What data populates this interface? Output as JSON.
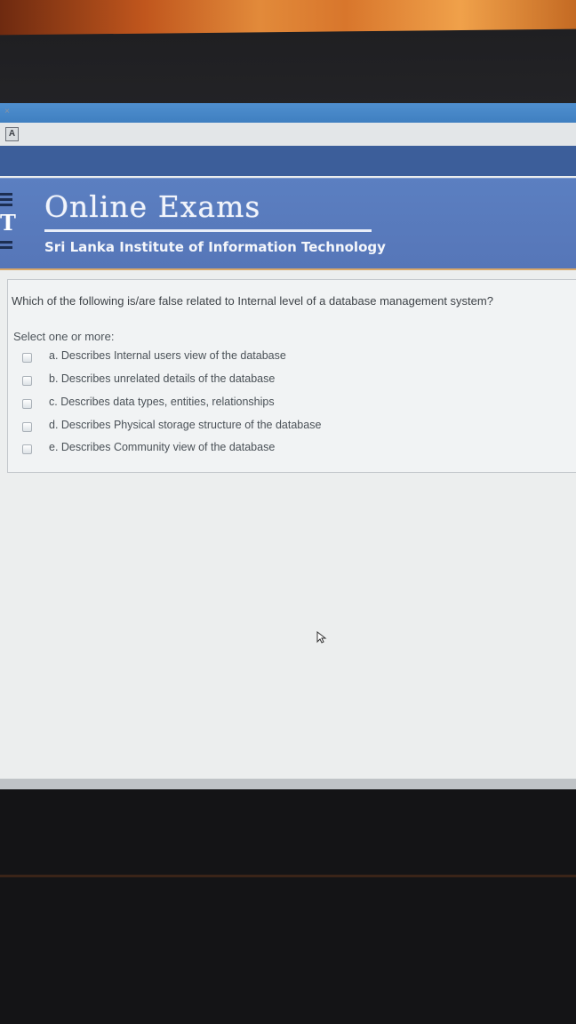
{
  "window": {
    "close_glyph": "×",
    "app_icon_glyph": "A"
  },
  "banner": {
    "title": "Online Exams",
    "subtitle": "Sri Lanka Institute of Information Technology",
    "logo_letter": "T"
  },
  "question": {
    "text": "Which of the following is/are false related to Internal level of a database management system?",
    "select_label": "Select one or more:",
    "answers": [
      {
        "label": "a. Describes Internal users view of the database",
        "checked": false
      },
      {
        "label": "b. Describes unrelated details of the database",
        "checked": false
      },
      {
        "label": "c. Describes data types, entities, relationships",
        "checked": false
      },
      {
        "label": "d. Describes Physical storage structure of the database",
        "checked": false
      },
      {
        "label": "e. Describes Community view of the database",
        "checked": false
      }
    ]
  },
  "colors": {
    "banner_blue": "#5676b8",
    "top_band": "#3c5e9a",
    "browser_strip": "#4f8fcf",
    "page_bg": "#eceeee"
  },
  "icons": {
    "cursor": "mouse-pointer-icon",
    "close": "close-icon",
    "app": "app-icon"
  }
}
